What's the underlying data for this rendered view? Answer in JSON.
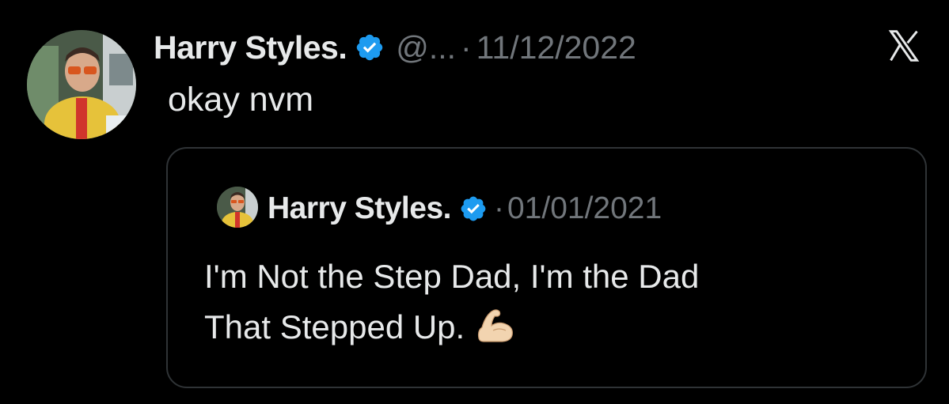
{
  "tweet": {
    "author_name": "Harry Styles.",
    "handle": "@...",
    "separator": "·",
    "date": "11/12/2022",
    "text": "okay nvm"
  },
  "quoted_tweet": {
    "author_name": "Harry Styles.",
    "separator": "·",
    "date": "01/01/2021",
    "text_line1": "I'm Not the Step Dad, I'm the Dad",
    "text_line2": "That Stepped Up.",
    "emoji": "flexed-biceps-icon"
  },
  "icons": {
    "verified_badge": "verified-badge-icon",
    "brand_logo": "x-logo-icon"
  },
  "colors": {
    "background": "#000000",
    "primary_text": "#e7e9ea",
    "secondary_text": "#71767b",
    "border": "#2f3336",
    "verified_blue": "#1d9bf0"
  }
}
